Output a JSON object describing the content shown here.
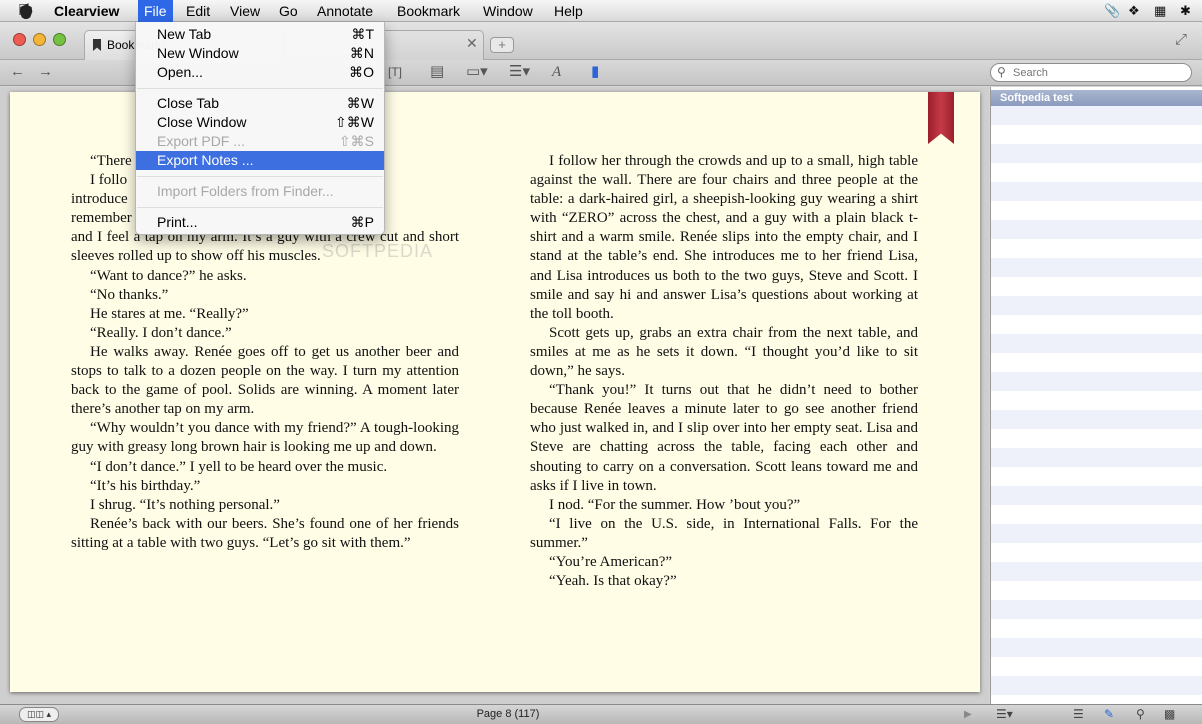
{
  "menubar": {
    "apple": "",
    "app_name": "Clearview",
    "items": [
      "File",
      "Edit",
      "View",
      "Go",
      "Annotate",
      "Bookmark",
      "Window",
      "Help"
    ]
  },
  "tabs": [
    {
      "label": "Bookmarks"
    }
  ],
  "search": {
    "placeholder": "Search"
  },
  "file_menu": {
    "items": [
      {
        "label": "New Tab",
        "shortcut": "⌘T",
        "enabled": true
      },
      {
        "label": "New Window",
        "shortcut": "⌘N",
        "enabled": true
      },
      {
        "label": "Open...",
        "shortcut": "⌘O",
        "enabled": true
      },
      {
        "label": "Close Tab",
        "shortcut": "⌘W",
        "enabled": true
      },
      {
        "label": "Close Window",
        "shortcut": "⇧⌘W",
        "enabled": true
      },
      {
        "label": "Export PDF ...",
        "shortcut": "⇧⌘S",
        "enabled": false
      },
      {
        "label": "Export Notes ...",
        "shortcut": "",
        "enabled": true,
        "highlighted": true
      },
      {
        "label": "Import Folders from Finder...",
        "shortcut": "",
        "enabled": false
      },
      {
        "label": "Print...",
        "shortcut": "⌘P",
        "enabled": true
      }
    ]
  },
  "watermark": "SOFTPEDIA",
  "sidebar": {
    "heading": "Softpedia test"
  },
  "book": {
    "left_column": [
      "“There",
      "I follo",
      "introduce",
      "remember",
      "and I feel a tap on my arm. It’s a guy with a crew cut and short sleeves rolled up to show off his muscles.",
      "“Want to dance?” he asks.",
      "“No thanks.”",
      "He stares at me. “Really?”",
      "“Really. I don’t dance.”",
      "He walks away. Renée goes off to get us another beer and stops to talk to a dozen people on the way. I turn my attention back to the game of pool. Solids are winning. A moment later there’s another tap on my arm.",
      "“Why wouldn’t you dance with my friend?” A tough-looking guy with greasy long brown hair is looking me up and down.",
      "“I don’t dance.” I yell to be heard over the music.",
      "“It’s his birthday.”",
      "I shrug. “It’s nothing personal.”",
      "Renée’s back with our beers. She’s found one of her friends sitting at a table with two guys. “Let’s go sit with them.”"
    ],
    "right_column": [
      "I follow her through the crowds and up to a small, high table against the wall. There are four chairs and three people at the table: a dark-haired girl, a sheepish-looking guy wearing a shirt with “ZERO” across the chest, and a guy with a plain black t-shirt and a warm smile. Renée slips into the empty chair, and I stand at the table’s end. She introduces me to her friend Lisa, and Lisa introduces us both to the two guys, Steve and Scott. I smile and say hi and answer Lisa’s questions about working at the toll booth.",
      "Scott gets up, grabs an extra chair from the next table, and smiles at me as he sets it down. “I thought you’d like to sit down,” he says.",
      "“Thank you!” It turns out that he didn’t need to bother because Renée leaves a minute later to go see another friend who just walked in, and I slip over into her empty seat. Lisa and Steve are chatting across the table, facing each other and shouting to carry on a conversation. Scott leans toward me and asks if I live in town.",
      "I nod. “For the summer. How ’bout you?”",
      "“I live on the U.S. side, in International Falls. For the summer.”",
      "“You’re American?”",
      "“Yeah. Is that okay?”"
    ]
  },
  "statusbar": {
    "page_label": "Page 8 (117)"
  },
  "colors": {
    "menu_highlight": "#3d6fe0",
    "page_bg": "#fffde6",
    "ribbon": "#b22d3a"
  }
}
